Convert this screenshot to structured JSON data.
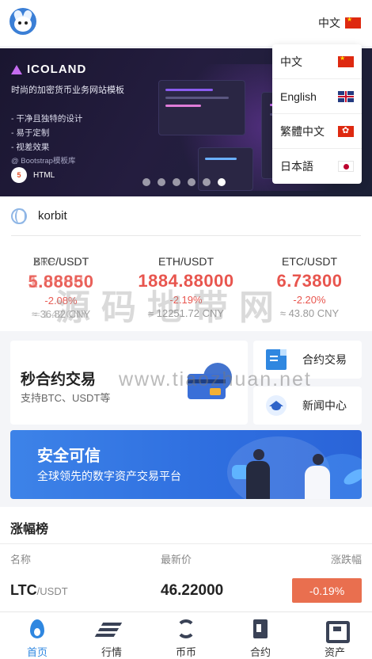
{
  "header": {
    "current_language": "中文",
    "current_flag": "flag-cn"
  },
  "language_menu": [
    {
      "label": "中文",
      "flag": "flag-cn"
    },
    {
      "label": "English",
      "flag": "flag-uk"
    },
    {
      "label": "繁體中文",
      "flag": "flag-hk"
    },
    {
      "label": "日本語",
      "flag": "flag-jp"
    }
  ],
  "banner": {
    "brand": "ICOLAND",
    "subtitle": "时尚的加密货币业务网站模板",
    "bullets": [
      "- 干净且独特的设计",
      "- 易于定制",
      "- 视差效果"
    ],
    "bootstrap_note": "@ Bootstrap模板库",
    "html_badge": "HTML",
    "slide_count": 6,
    "active_slide": 6
  },
  "exchange": {
    "name": "korbit",
    "icon": "globe-icon"
  },
  "tickers": [
    {
      "pair": "BTC/USDT",
      "pair_overlap": "XRP/USDT",
      "price": "5.88850",
      "price_overlap": "1.06080",
      "change": "-2.08%",
      "change_overlap": "-2.00%",
      "cny": "≈ 36.82 CNY",
      "cny_overlap": "≈ 1.42 CNY"
    },
    {
      "pair": "ETH/USDT",
      "price": "1884.88000",
      "change": "-2.19%",
      "cny": "≈ 12251.72 CNY"
    },
    {
      "pair": "ETC/USDT",
      "price": "6.73800",
      "change": "-2.20%",
      "cny": "≈ 43.80 CNY"
    }
  ],
  "feature": {
    "title": "秒合约交易",
    "subtitle": "支持BTC、USDT等",
    "buttons": [
      {
        "label": "合约交易",
        "icon": "document-icon"
      },
      {
        "label": "新闻中心",
        "icon": "graduation-cap-icon"
      }
    ]
  },
  "promo": {
    "title": "安全可信",
    "subtitle": "全球领先的数字资产交易平台"
  },
  "ranking": {
    "title": "涨幅榜",
    "headers": {
      "name": "名称",
      "price": "最新价",
      "change": "涨跌幅"
    },
    "rows": [
      {
        "coin": "LTC",
        "quote": "/USDT",
        "price": "46.22000",
        "change": "-0.19%"
      }
    ]
  },
  "watermark": {
    "line1": "源码地带网",
    "line2": "www.tiaozhuan.net"
  },
  "tabbar": [
    {
      "label": "首页",
      "icon": "fire-icon",
      "active": true
    },
    {
      "label": "行情",
      "icon": "market-icon",
      "active": false
    },
    {
      "label": "币币",
      "icon": "exchange-arrows-icon",
      "active": false
    },
    {
      "label": "合约",
      "icon": "contract-icon",
      "active": false
    },
    {
      "label": "资产",
      "icon": "wallet-icon",
      "active": false
    }
  ],
  "colors": {
    "accent": "#2f87e0",
    "down": "#e8554e",
    "badge_down": "#e96f4f"
  }
}
